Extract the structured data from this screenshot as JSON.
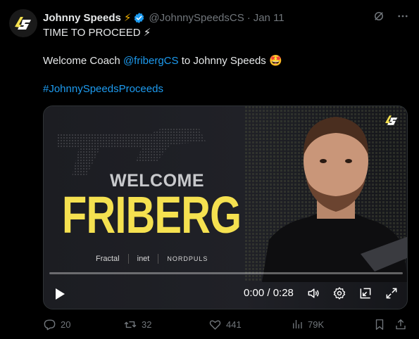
{
  "tweet": {
    "author_name": "Johnny Speeds",
    "author_emoji": "⚡",
    "handle": "@JohnnySpeedsCS",
    "separator": "·",
    "date": "Jan 11",
    "avatar_text": "JS",
    "line1": "TIME TO PROCEED ⚡",
    "line2_prefix": "Welcome Coach ",
    "line2_mention": "@fribergCS",
    "line2_suffix": " to Johnny Speeds 🤩",
    "hashtag": "#JohnnySpeedsProceeds"
  },
  "media": {
    "welcome": "WELCOME",
    "name": "FRIBERG",
    "corner_logo": "JS",
    "sponsors": [
      "Fractal",
      "inet",
      "NORDPULS"
    ],
    "time": "0:00 / 0:28",
    "progress": 0
  },
  "actions": {
    "replies": "20",
    "reposts": "32",
    "likes": "441",
    "views": "79K"
  },
  "colors": {
    "link": "#1d9bf0",
    "muted": "#71767b",
    "headline_yellow": "#f5e150",
    "bolt": "#f5b400"
  }
}
